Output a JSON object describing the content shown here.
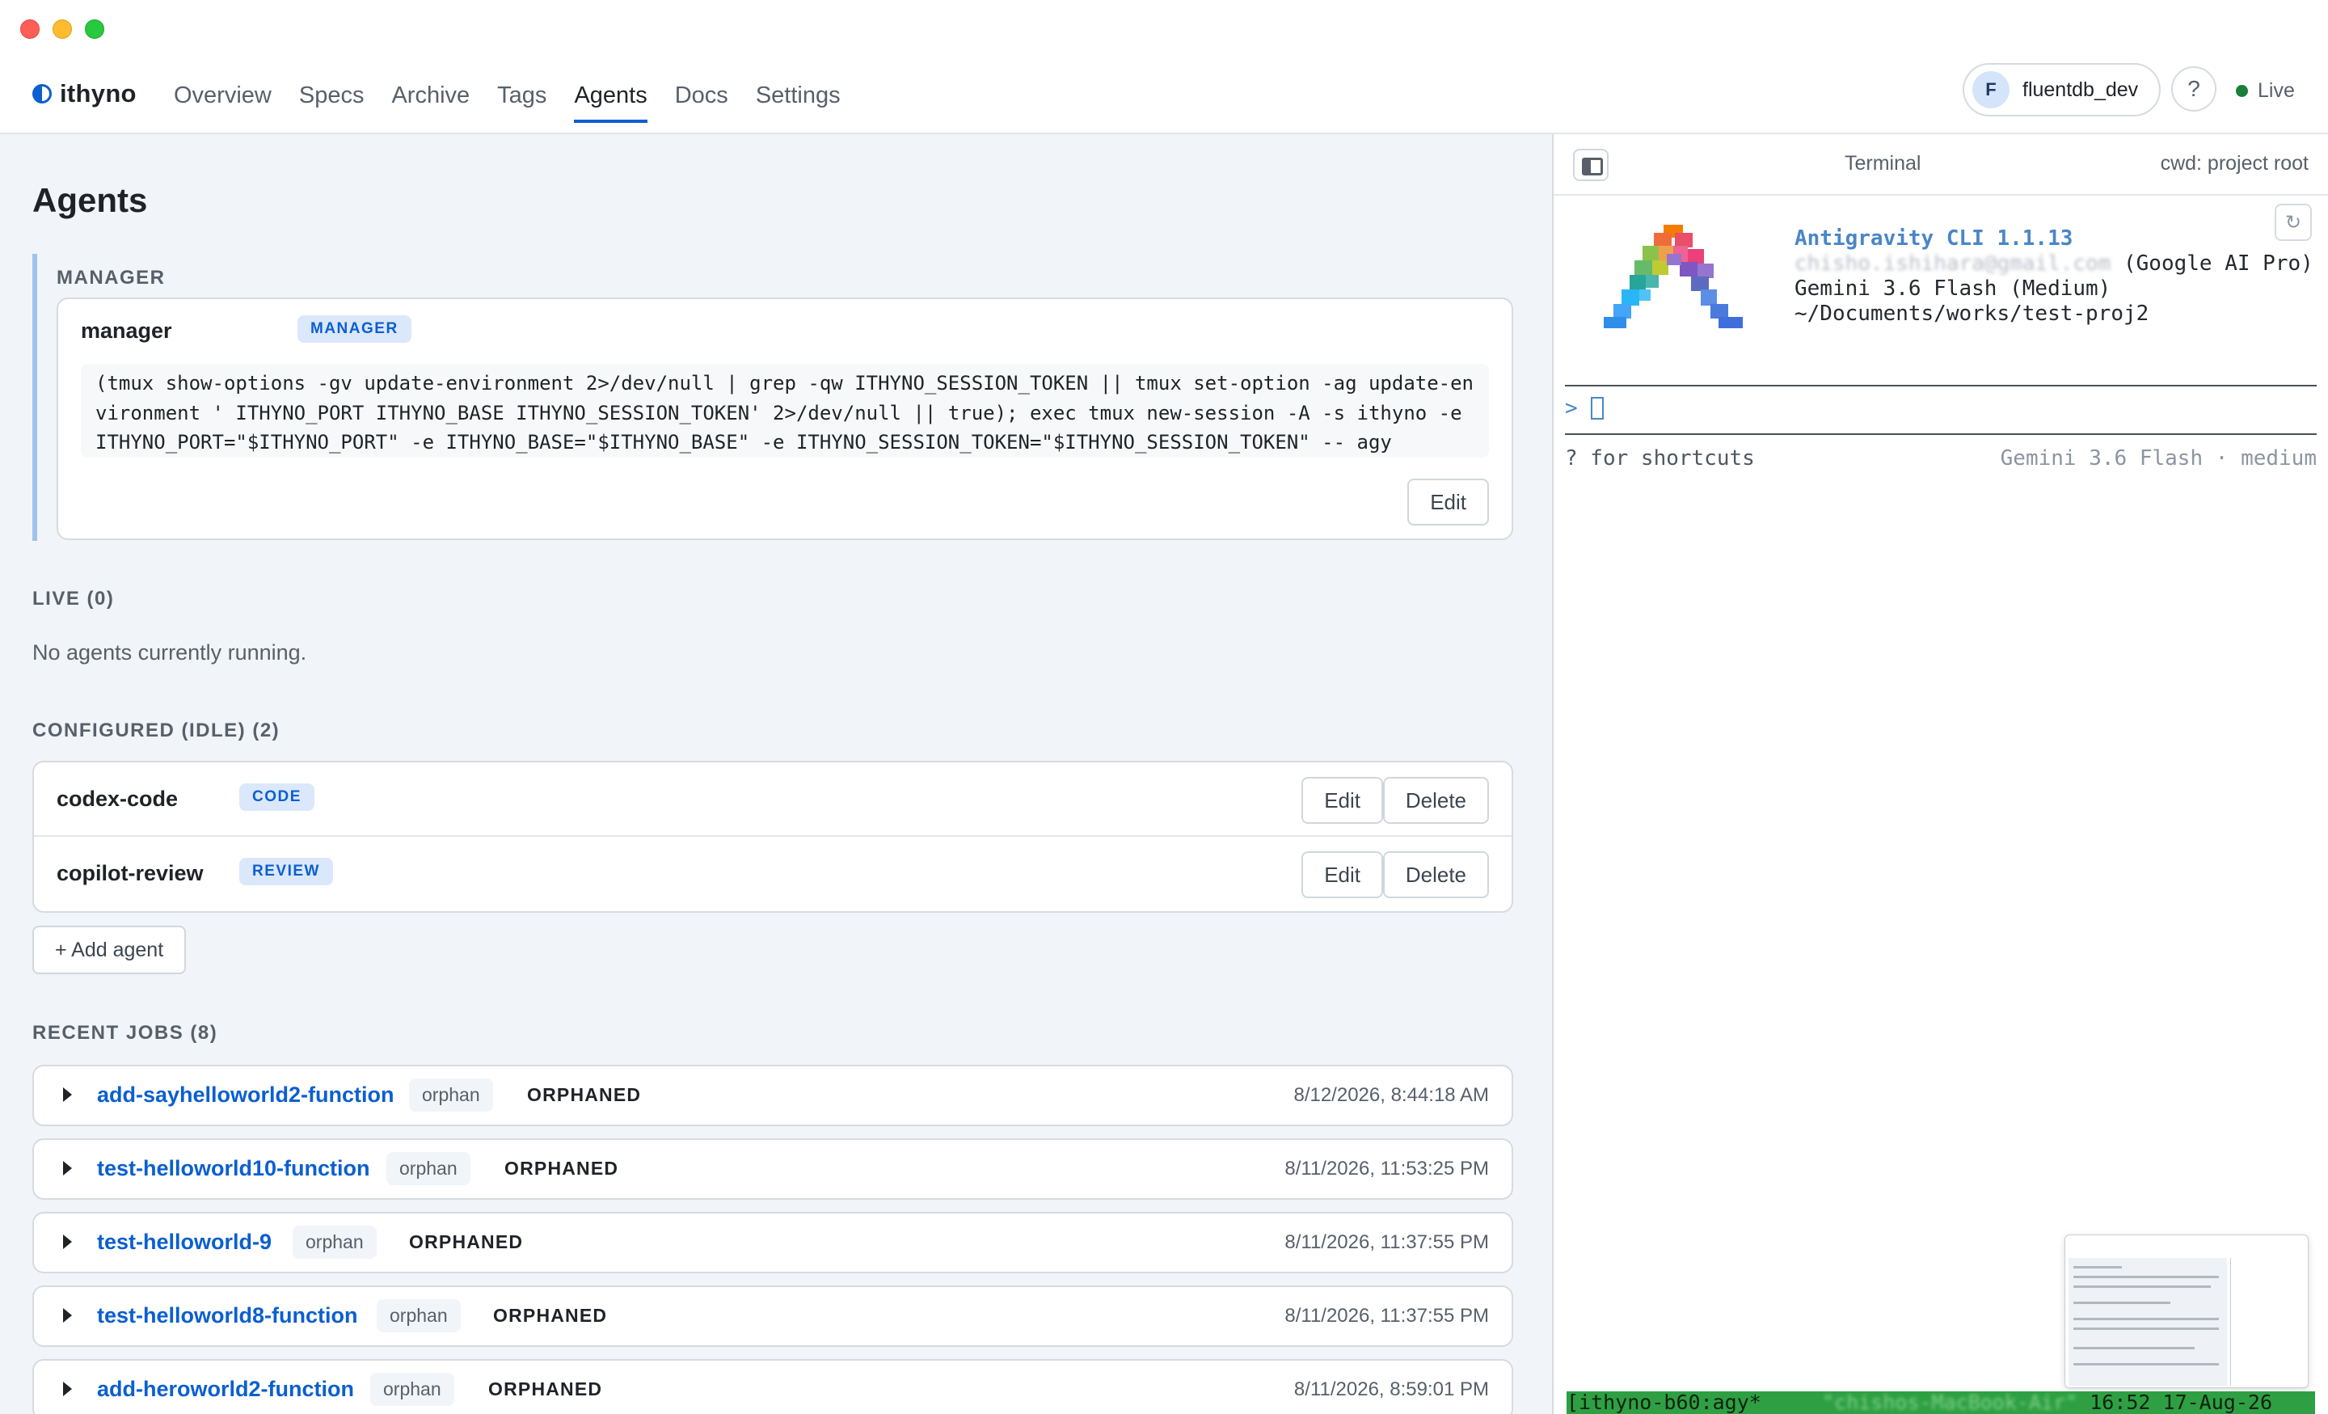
{
  "app": {
    "brand": "ithyno"
  },
  "nav": {
    "items": [
      {
        "label": "Overview"
      },
      {
        "label": "Specs"
      },
      {
        "label": "Archive"
      },
      {
        "label": "Tags"
      },
      {
        "label": "Agents",
        "active": true
      },
      {
        "label": "Docs"
      },
      {
        "label": "Settings"
      }
    ]
  },
  "user": {
    "initial": "F",
    "name": "fluentdb_dev"
  },
  "help": {
    "label": "?"
  },
  "status": {
    "label": "Live",
    "color": "#1a7f37"
  },
  "page": {
    "title": "Agents"
  },
  "manager": {
    "section_label": "MANAGER",
    "name": "manager",
    "badge": "MANAGER",
    "command": "(tmux show-options -gv update-environment 2>/dev/null | grep -qw ITHYNO_SESSION_TOKEN || tmux set-option -ag update-environment ' ITHYNO_PORT ITHYNO_BASE ITHYNO_SESSION_TOKEN' 2>/dev/null || true); exec tmux new-session -A -s ithyno -e ITHYNO_PORT=\"$ITHYNO_PORT\" -e ITHYNO_BASE=\"$ITHYNO_BASE\" -e ITHYNO_SESSION_TOKEN=\"$ITHYNO_SESSION_TOKEN\" -- agy",
    "edit_label": "Edit"
  },
  "live": {
    "section_label": "LIVE (0)",
    "empty_text": "No agents currently running."
  },
  "configured": {
    "section_label": "CONFIGURED (IDLE) (2)",
    "agents": [
      {
        "name": "codex-code",
        "badge": "CODE",
        "edit_label": "Edit",
        "delete_label": "Delete"
      },
      {
        "name": "copilot-review",
        "badge": "REVIEW",
        "edit_label": "Edit",
        "delete_label": "Delete"
      }
    ],
    "add_label": "+ Add agent"
  },
  "recent_jobs": {
    "section_label": "RECENT JOBS (8)",
    "jobs": [
      {
        "name": "add-sayhelloworld2-function",
        "tag": "orphan",
        "status": "ORPHANED",
        "time": "8/12/2026, 8:44:18 AM"
      },
      {
        "name": "test-helloworld10-function",
        "tag": "orphan",
        "status": "ORPHANED",
        "time": "8/11/2026, 11:53:25 PM"
      },
      {
        "name": "test-helloworld-9",
        "tag": "orphan",
        "status": "ORPHANED",
        "time": "8/11/2026, 11:37:55 PM"
      },
      {
        "name": "test-helloworld8-function",
        "tag": "orphan",
        "status": "ORPHANED",
        "time": "8/11/2026, 11:37:55 PM"
      },
      {
        "name": "add-heroworld2-function",
        "tag": "orphan",
        "status": "ORPHANED",
        "time": "8/11/2026, 8:59:01 PM"
      }
    ]
  },
  "terminal": {
    "title": "Terminal",
    "cwd": "cwd: project root",
    "refresh_icon": "↻",
    "cli_title": "Antigravity CLI 1.1.13",
    "account_email": "chisho.ishihara@gmail.com",
    "account_plan": "(Google AI Pro)",
    "model_line": "Gemini 3.6 Flash (Medium)",
    "path_line": "~/Documents/works/test-proj2",
    "prompt_symbol": ">",
    "shortcuts_hint": "? for shortcuts",
    "model_status": "Gemini 3.6 Flash · medium",
    "tmux_session": "[ithyno-b60:agy*",
    "tmux_host": "\"chishos-MacBook-Air\"",
    "tmux_time": " 16:52 17-Aug-26"
  }
}
